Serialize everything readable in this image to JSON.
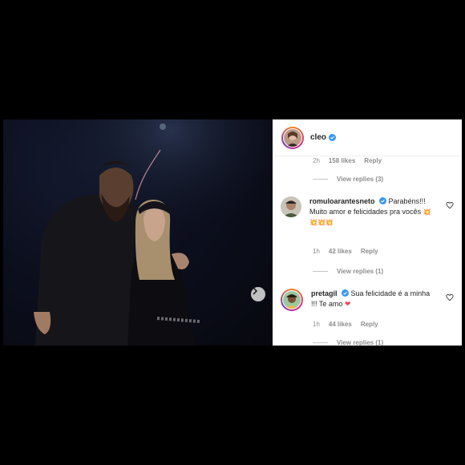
{
  "post": {
    "author": "cleo",
    "author_verified": true,
    "carousel_next_icon": "chevron-right-icon",
    "top_comment_meta": {
      "time": "2h",
      "likes": "158 likes",
      "reply": "Reply"
    },
    "top_comment_replies": "View replies (3)"
  },
  "comments": [
    {
      "username": "romuloarantesneto",
      "verified": true,
      "text": "Parabéns!!! Muito amor e felicidades pra vocês",
      "emoji": "💥💥💥💥",
      "time": "1h",
      "likes": "42 likes",
      "reply": "Reply",
      "replies": "View replies (1)"
    },
    {
      "username": "pretagil",
      "verified": true,
      "text": "Sua felicidade é a minha !!! Te amo",
      "emoji": "❤",
      "time": "1h",
      "likes": "44 likes",
      "reply": "Reply",
      "replies": "View replies (1)"
    }
  ],
  "colors": {
    "verified_blue": "#3897f0",
    "heart_red": "#ed4956",
    "muted_text": "#8e8e8e"
  }
}
